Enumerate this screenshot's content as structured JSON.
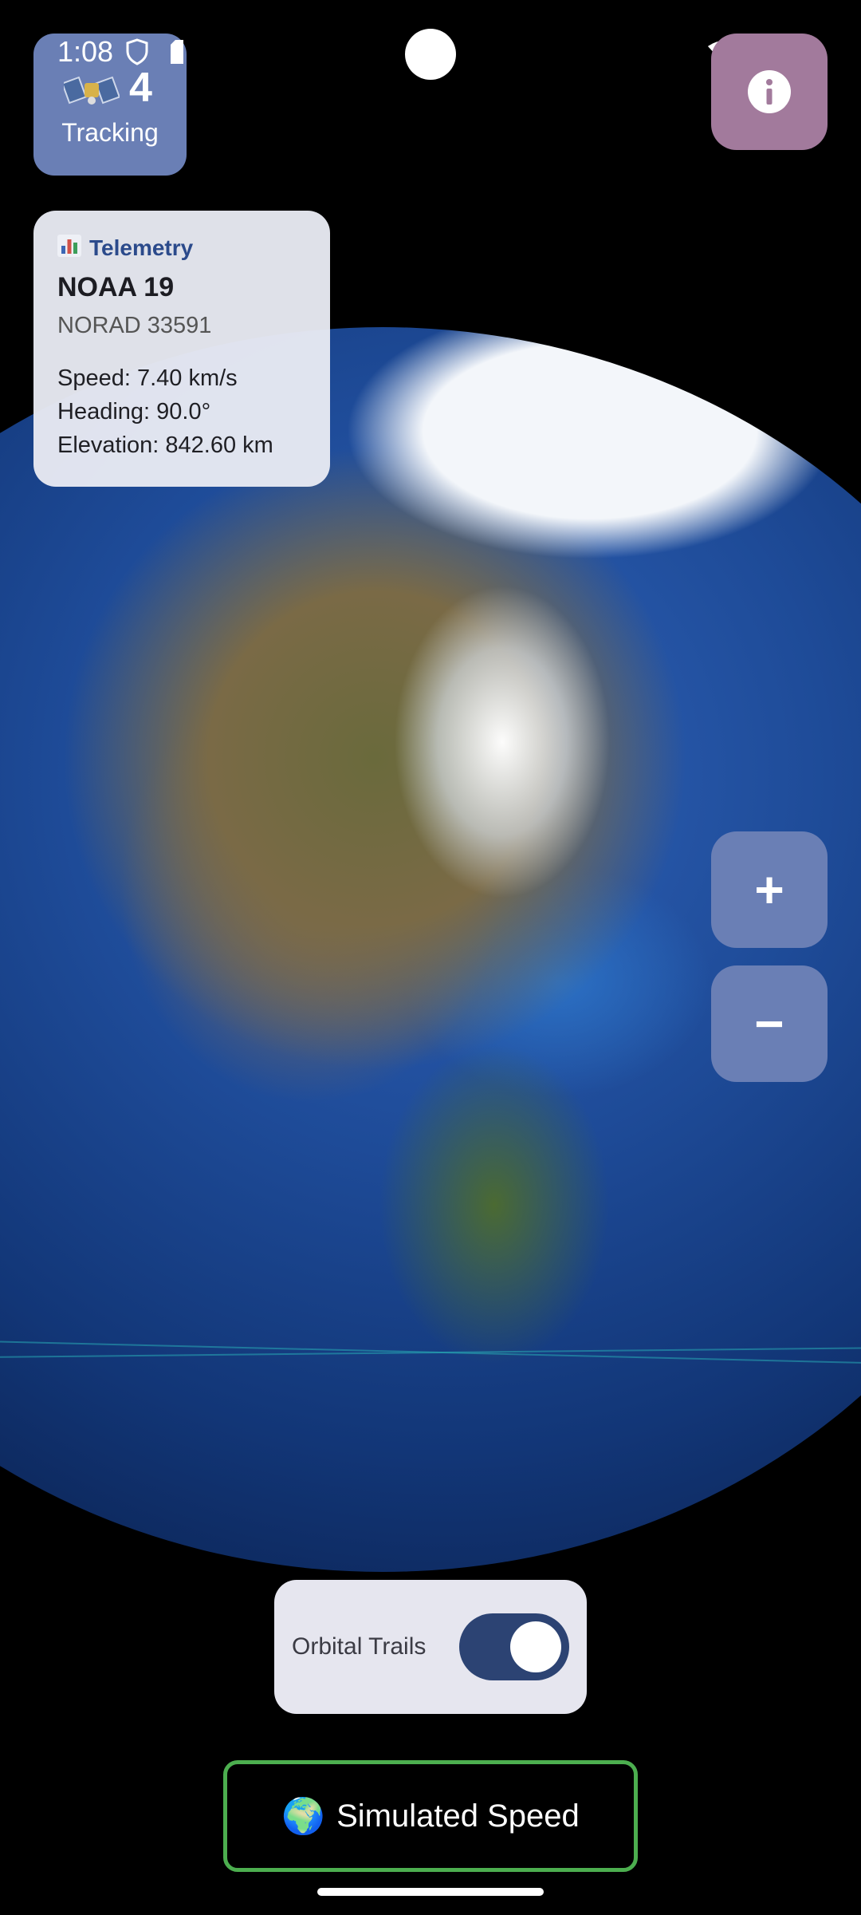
{
  "status_bar": {
    "time": "1:08"
  },
  "tracking": {
    "count": "4",
    "label": "Tracking"
  },
  "telemetry": {
    "header": "Telemetry",
    "satellite_name": "NOAA 19",
    "norad": "NORAD 33591",
    "speed": "Speed: 7.40 km/s",
    "heading": "Heading: 90.0°",
    "elevation": "Elevation: 842.60 km"
  },
  "zoom": {
    "in_label": "+",
    "out_label": "−"
  },
  "trails": {
    "label": "Orbital Trails",
    "enabled": true
  },
  "speed_button": {
    "icon": "🌍",
    "label": "Simulated Speed"
  },
  "colors": {
    "accent_blue": "#6a7fb5",
    "info_purple": "#a27a9c",
    "toggle_on": "#2c4373",
    "speed_border": "#4cae4f"
  }
}
